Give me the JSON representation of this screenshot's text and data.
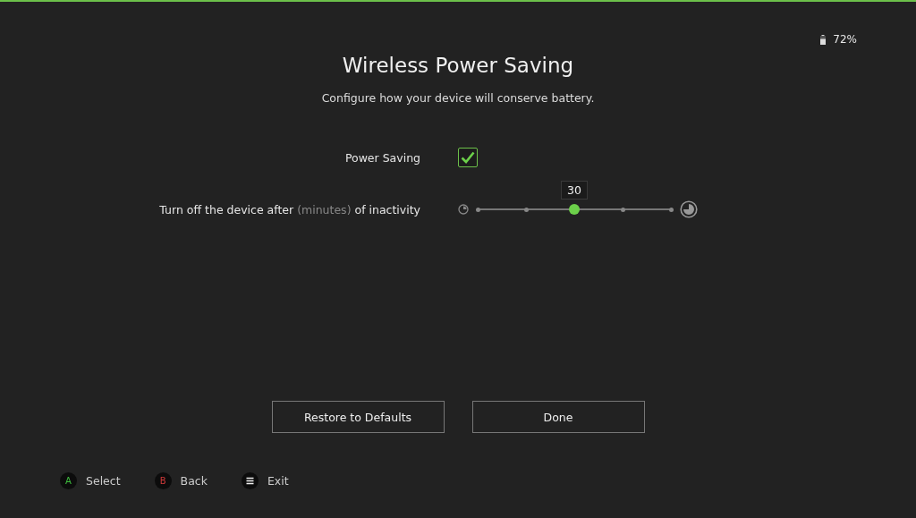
{
  "battery": {
    "text": "72%"
  },
  "title": "Wireless Power Saving",
  "subtitle": "Configure how your device will conserve battery.",
  "settings": [
    {
      "kind": "checkbox",
      "label": "Power Saving",
      "checked": true
    },
    {
      "kind": "slider",
      "label": "Turn off the device after",
      "unit": "(minutes)",
      "label_end": "of inactivity",
      "value": "30",
      "level": 0.5
    }
  ],
  "buttons": [
    {
      "label": "Restore to Defaults"
    },
    {
      "label": "Done"
    }
  ],
  "hints": [
    {
      "kind": "letter",
      "key": "A",
      "color": "#3fbf3f",
      "label": "Select"
    },
    {
      "kind": "letter",
      "key": "B",
      "color": "#d03a3a",
      "label": "Back"
    },
    {
      "kind": "menu",
      "label": "Exit"
    }
  ]
}
